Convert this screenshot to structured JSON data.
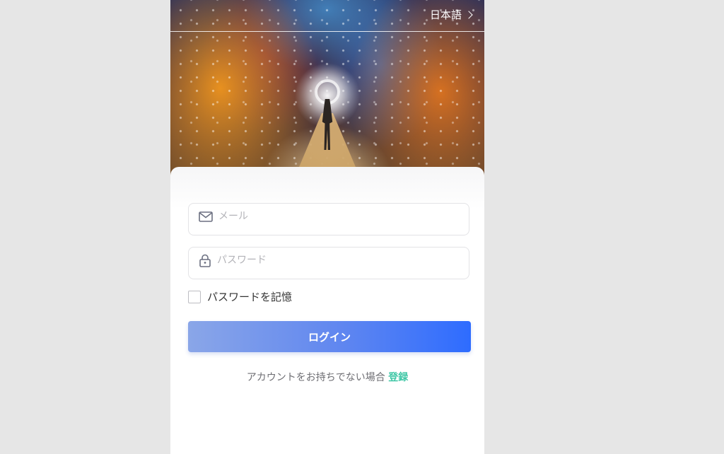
{
  "header": {
    "language": "日本語"
  },
  "form": {
    "email_placeholder": "メール",
    "password_placeholder": "パスワード",
    "remember_label": "パスワードを記憶",
    "remember_checked": false,
    "login_label": "ログイン"
  },
  "signup": {
    "prompt": "アカウントをお持ちでない場合",
    "link_label": "登録"
  },
  "colors": {
    "accent": "#2e6cff",
    "link": "#3fc7a6"
  },
  "icons": {
    "email": "envelope-icon",
    "password": "lock-icon",
    "language": "chevron-right-icon"
  }
}
